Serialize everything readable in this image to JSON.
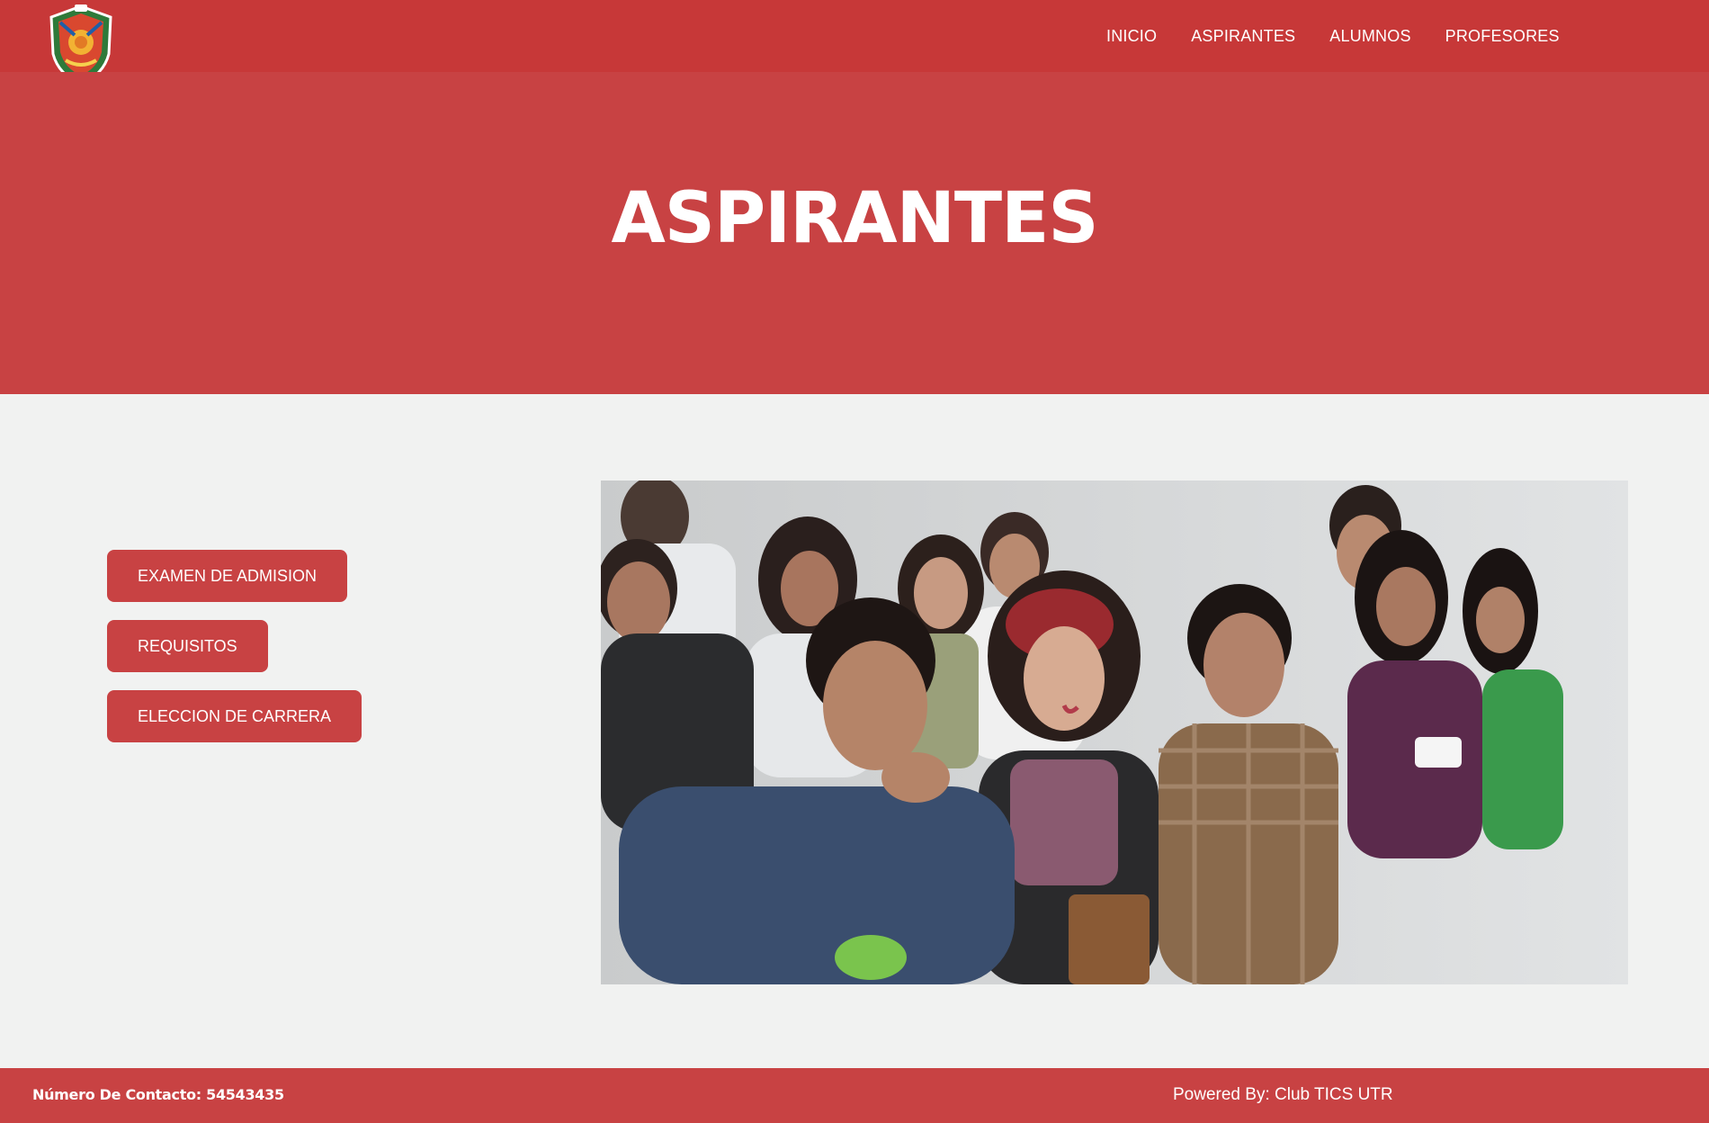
{
  "nav": {
    "items": [
      {
        "label": "INICIO"
      },
      {
        "label": "ASPIRANTES"
      },
      {
        "label": "ALUMNOS"
      },
      {
        "label": "PROFESORES"
      }
    ]
  },
  "hero": {
    "title": "ASPIRANTES"
  },
  "sidebar": {
    "buttons": [
      {
        "label": "EXAMEN DE ADMISION"
      },
      {
        "label": "REQUISITOS"
      },
      {
        "label": "ELECCION DE CARRERA"
      }
    ]
  },
  "footer": {
    "contact": "Número De Contacto: 54543435",
    "powered_by": "Powered By: Club TICS UTR"
  },
  "colors": {
    "brand_red": "#c84243",
    "topbar_red": "#c73838",
    "background": "#f1f2f1"
  },
  "icons": {
    "logo": "university-crest-icon"
  }
}
